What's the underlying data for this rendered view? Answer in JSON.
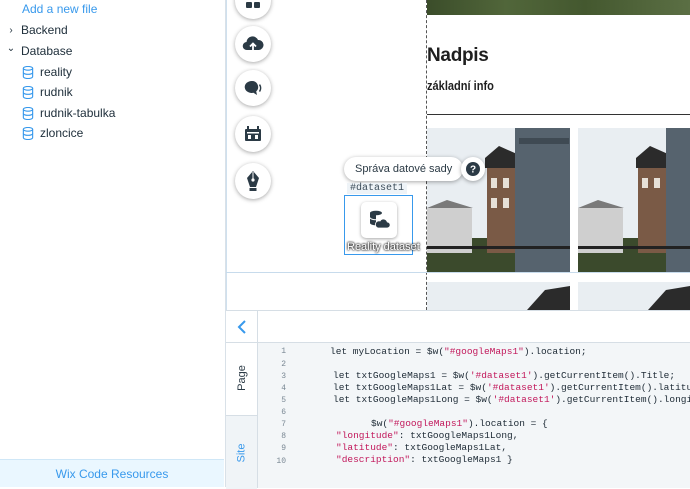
{
  "sidebar": {
    "add_file": "Add a new file",
    "items": [
      {
        "label": "Backend",
        "chevron": "›"
      },
      {
        "label": "Database",
        "chevron": "⌄"
      },
      {
        "label": "reality"
      },
      {
        "label": "rudnik"
      },
      {
        "label": "rudnik-tabulka"
      },
      {
        "label": "zloncice"
      }
    ],
    "resources": "Wix Code Resources"
  },
  "toolbar": {
    "buttons": [
      "apps-icon",
      "upload-icon",
      "chat-icon",
      "store-icon",
      "pen-icon"
    ]
  },
  "canvas": {
    "heading": "Nadpis",
    "subheading": "základní info",
    "tooltip": "Správa datové sady",
    "help": "?",
    "dataset_id": "#dataset1",
    "dataset_label": "Reality dataset"
  },
  "code_panel": {
    "back": "‹",
    "tabs": {
      "page": "Page",
      "site": "Site"
    },
    "line_numbers": [
      "1",
      "2",
      "3",
      "4",
      "5",
      "6",
      "7",
      "8",
      "9",
      "10"
    ]
  },
  "colors": {
    "accent": "#3899ec",
    "string": "#c2185b"
  }
}
